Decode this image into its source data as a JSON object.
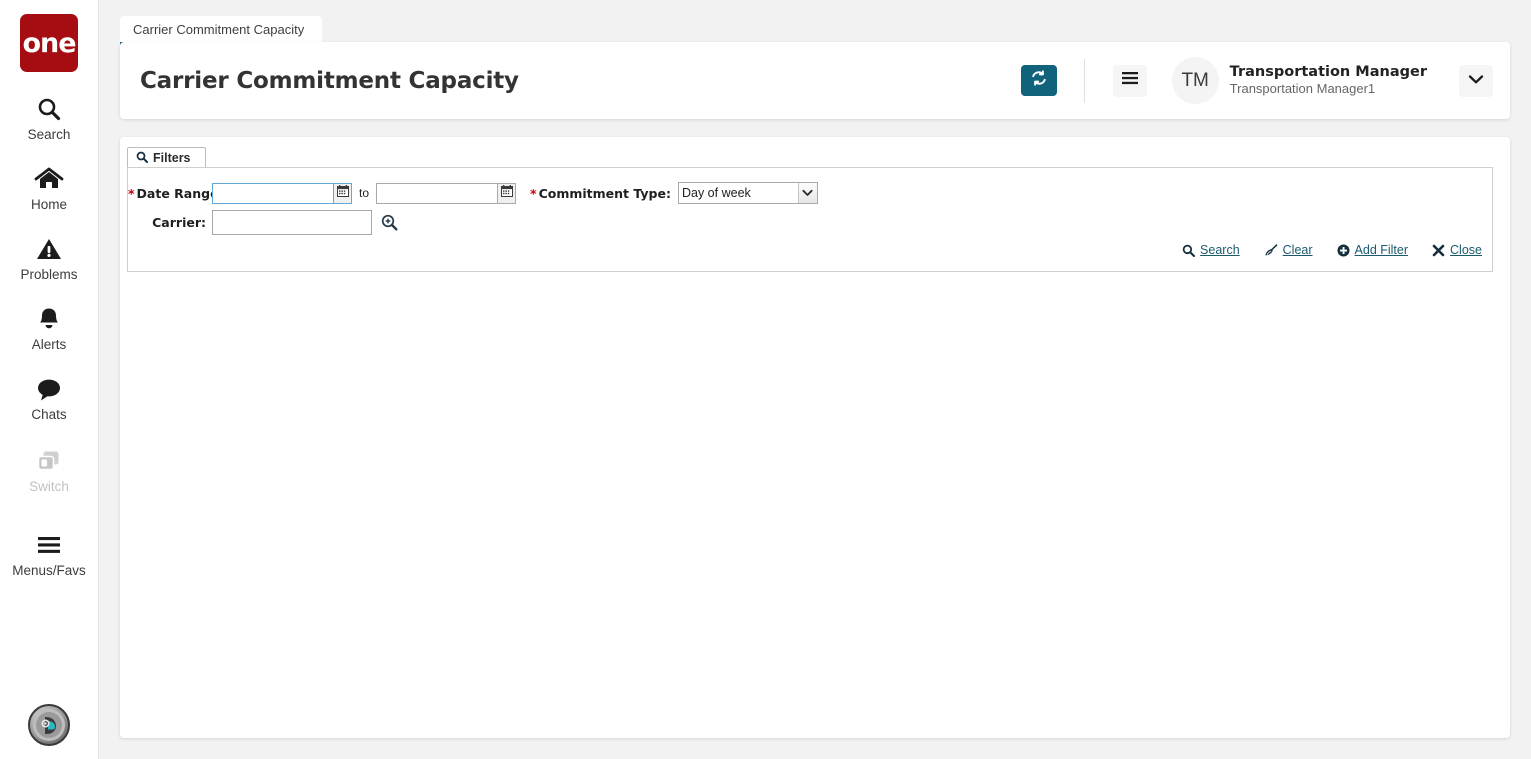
{
  "colors": {
    "brand_red": "#a50d12",
    "teal": "#10637a",
    "tab_underline": "#0d6579",
    "link": "#1b5a6e",
    "required_star": "#cc0000",
    "focus_border": "#62a8dd"
  },
  "sidebar": {
    "logo_text": "one",
    "items": [
      {
        "label": "Search",
        "icon": "search-icon",
        "disabled": false
      },
      {
        "label": "Home",
        "icon": "home-icon",
        "disabled": false
      },
      {
        "label": "Problems",
        "icon": "warning-icon",
        "disabled": false
      },
      {
        "label": "Alerts",
        "icon": "bell-icon",
        "disabled": false
      },
      {
        "label": "Chats",
        "icon": "chat-icon",
        "disabled": false
      },
      {
        "label": "Switch",
        "icon": "switch-icon",
        "disabled": true
      },
      {
        "label": "Menus/Favs",
        "icon": "hamburger-icon",
        "disabled": false
      }
    ],
    "bottom_avatar_icon": "user-profile-avatar-icon"
  },
  "tabs": [
    {
      "label": "Carrier Commitment Capacity",
      "active": true
    }
  ],
  "header": {
    "title": "Carrier Commitment Capacity",
    "refresh_icon": "refresh-icon",
    "menu_icon": "hamburger-icon",
    "avatar_initials": "TM",
    "user_name": "Transportation Manager",
    "user_subtitle": "Transportation Manager1",
    "chevron_icon": "chevron-down-icon"
  },
  "filters": {
    "tab_label": "Filters",
    "tab_icon": "search-icon",
    "date_range": {
      "label": "Date Range:",
      "required": true,
      "from_value": "",
      "from_placeholder": "",
      "to_separator": "to",
      "to_value": "",
      "to_placeholder": "",
      "calendar_icon": "calendar-icon"
    },
    "commitment_type": {
      "label": "Commitment Type:",
      "required": true,
      "selected": "Day of week",
      "options": [
        "Day of week"
      ],
      "chevron_icon": "chevron-down-icon"
    },
    "carrier": {
      "label": "Carrier:",
      "required": false,
      "value": "",
      "placeholder": "",
      "lookup_icon": "magnifier-plus-icon"
    },
    "actions": [
      {
        "label": "Search",
        "icon": "search-icon"
      },
      {
        "label": "Clear",
        "icon": "broom-icon"
      },
      {
        "label": "Add Filter",
        "icon": "plus-circle-icon"
      },
      {
        "label": "Close",
        "icon": "close-x-icon"
      }
    ]
  }
}
